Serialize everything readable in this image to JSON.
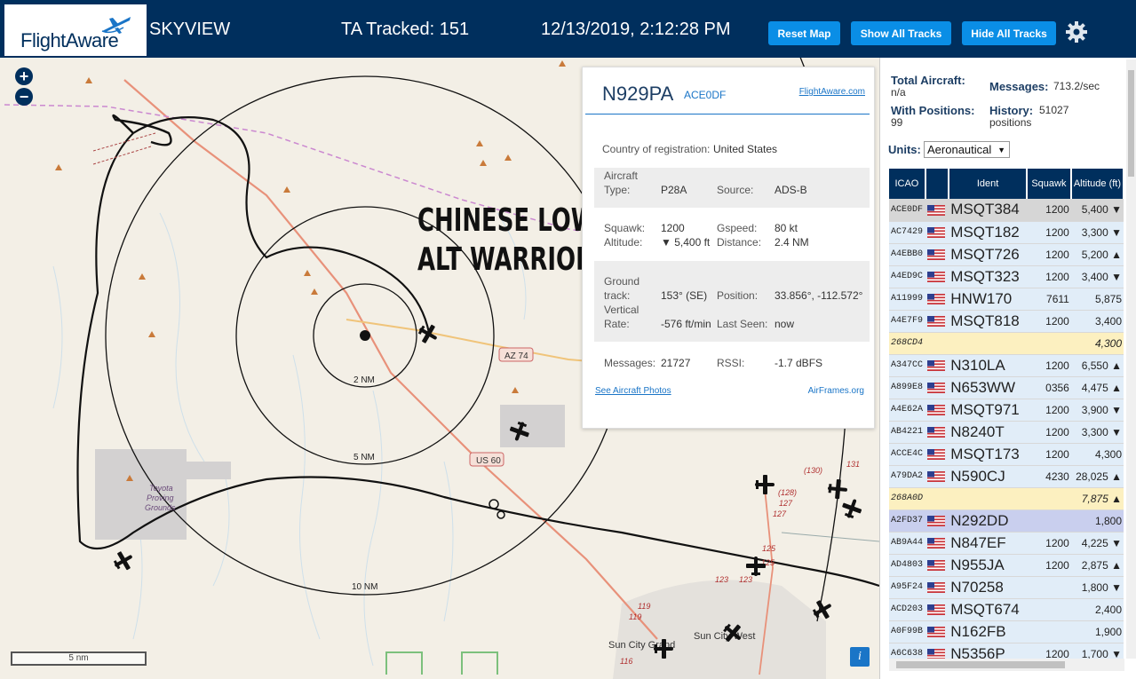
{
  "header": {
    "logo": "FlightAware",
    "app_name": "SKYVIEW",
    "tracked": "TA Tracked: 151",
    "datetime": "12/13/2019, 2:12:28 PM",
    "buttons": {
      "reset_map": "Reset Map",
      "show_all": "Show All Tracks",
      "hide_all": "Hide All Tracks"
    }
  },
  "map": {
    "overlay_title_line1": "CHINESE LOW",
    "overlay_title_line2": "ALT WARRIOR",
    "zoom_in": "+",
    "zoom_out": "−",
    "range_labels": [
      "2 NM",
      "5 NM",
      "10 NM"
    ],
    "road_labels": [
      "AZ 74",
      "US 60"
    ],
    "place_labels": [
      "Toyota",
      "Proving",
      "Grounds",
      "Sun City Grand",
      "Sun City West"
    ],
    "route_numbers": [
      "(130)",
      "131",
      "(128)",
      "127",
      "127",
      "125",
      "125",
      "123",
      "123",
      "119",
      "119",
      "116"
    ],
    "scale": "5 nm",
    "info": "i"
  },
  "popup": {
    "registration": "N929PA",
    "hex": "ACE0DF",
    "fa_link": "FlightAware.com",
    "country_label": "Country of registration:",
    "country": "United States",
    "type_label_1": "Aircraft",
    "type_label_2": "Type:",
    "type": "P28A",
    "source_label": "Source:",
    "source": "ADS-B",
    "squawk_label": "Squawk:",
    "squawk": "1200",
    "gspeed_label": "Gspeed:",
    "gspeed": "80 kt",
    "altitude_label": "Altitude:",
    "altitude": "▼ 5,400 ft",
    "distance_label": "Distance:",
    "distance": "2.4 NM",
    "track_label_1": "Ground",
    "track_label_2": "track:",
    "track": "153° (SE)",
    "position_label": "Position:",
    "position": "33.856°, -112.572°",
    "vrate_label_1": "Vertical",
    "vrate_label_2": "Rate:",
    "vrate": "-576 ft/min",
    "lastseen_label": "Last Seen:",
    "lastseen": "now",
    "messages_label": "Messages:",
    "messages": "21727",
    "rssi_label": "RSSI:",
    "rssi": "-1.7 dBFS",
    "photos_link": "See Aircraft Photos",
    "airframes_link": "AirFrames.org"
  },
  "panel": {
    "total_label": "Total Aircraft:",
    "total": "n/a",
    "messages_label": "Messages:",
    "messages": "713.2/sec",
    "withpos_label": "With Positions:",
    "withpos": "99",
    "history_label": "History:",
    "history": "51027",
    "history_unit": "positions",
    "units_label": "Units:",
    "units_value": "Aeronautical",
    "columns": [
      "ICAO",
      "",
      "Ident",
      "Squawk",
      "Altitude (ft)"
    ],
    "rows": [
      {
        "icao": "ACE0DF",
        "flag": true,
        "ident": "MSQT384",
        "squawk": "1200",
        "alt": "5,400 ▼"
      },
      {
        "icao": "AC7429",
        "flag": true,
        "ident": "MSQT182",
        "squawk": "1200",
        "alt": "3,300 ▼"
      },
      {
        "icao": "A4EBB0",
        "flag": true,
        "ident": "MSQT726",
        "squawk": "1200",
        "alt": "5,200 ▲"
      },
      {
        "icao": "A4ED9C",
        "flag": true,
        "ident": "MSQT323",
        "squawk": "1200",
        "alt": "3,400 ▼"
      },
      {
        "icao": "A11999",
        "flag": true,
        "ident": "HNW170",
        "squawk": "7611",
        "alt": "5,875"
      },
      {
        "icao": "A4E7F9",
        "flag": true,
        "ident": "MSQT818",
        "squawk": "1200",
        "alt": "3,400"
      },
      {
        "icao": "268CD4",
        "flag": false,
        "ident": "",
        "squawk": "",
        "alt": "4,300"
      },
      {
        "icao": "A347CC",
        "flag": true,
        "ident": "N310LA",
        "squawk": "1200",
        "alt": "6,550 ▲"
      },
      {
        "icao": "A899E8",
        "flag": true,
        "ident": "N653WW",
        "squawk": "0356",
        "alt": "4,475 ▲"
      },
      {
        "icao": "A4E62A",
        "flag": true,
        "ident": "MSQT971",
        "squawk": "1200",
        "alt": "3,900 ▼"
      },
      {
        "icao": "AB4221",
        "flag": true,
        "ident": "N8240T",
        "squawk": "1200",
        "alt": "3,300 ▼"
      },
      {
        "icao": "ACCE4C",
        "flag": true,
        "ident": "MSQT173",
        "squawk": "1200",
        "alt": "4,300"
      },
      {
        "icao": "A79DA2",
        "flag": true,
        "ident": "N590CJ",
        "squawk": "4230",
        "alt": "28,025 ▲"
      },
      {
        "icao": "268A0D",
        "flag": false,
        "ident": "",
        "squawk": "",
        "alt": "7,875 ▲"
      },
      {
        "icao": "A2FD37",
        "flag": true,
        "ident": "N292DD",
        "squawk": "",
        "alt": "1,800"
      },
      {
        "icao": "AB9A44",
        "flag": true,
        "ident": "N847EF",
        "squawk": "1200",
        "alt": "4,225 ▼"
      },
      {
        "icao": "AD4803",
        "flag": true,
        "ident": "N955JA",
        "squawk": "1200",
        "alt": "2,875 ▲"
      },
      {
        "icao": "A95F24",
        "flag": true,
        "ident": "N70258",
        "squawk": "",
        "alt": "1,800 ▼"
      },
      {
        "icao": "ACD203",
        "flag": true,
        "ident": "MSQT674",
        "squawk": "",
        "alt": "2,400"
      },
      {
        "icao": "A0F99B",
        "flag": true,
        "ident": "N162FB",
        "squawk": "",
        "alt": "1,900"
      },
      {
        "icao": "A6C638",
        "flag": true,
        "ident": "N5356P",
        "squawk": "1200",
        "alt": "1,700 ▼"
      }
    ]
  },
  "colors": {
    "header_bg": "#002f5d",
    "button_bg": "#0a8ee6",
    "map_bg": "#f3efe6",
    "track": "#111111",
    "row_blue": "#e1edf8",
    "row_yellow": "#fcf0c0",
    "row_selected": "#d6d6d6",
    "row_highlight": "#c9cfee"
  },
  "icons": [
    "plane-logo-icon",
    "gear-icon",
    "zoom-in-icon",
    "zoom-out-icon",
    "aircraft-icon",
    "us-flag-icon",
    "info-icon",
    "receiver-dot-icon"
  ]
}
